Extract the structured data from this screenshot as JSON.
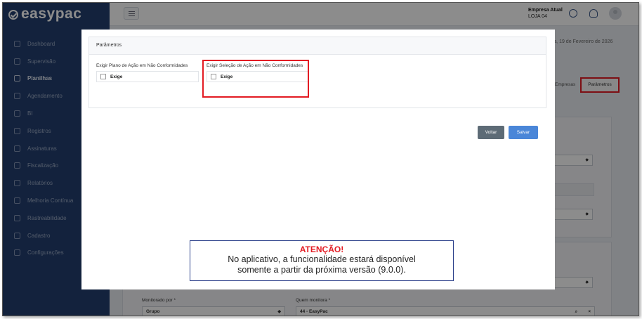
{
  "app": {
    "logo": "easypac"
  },
  "topbar": {
    "company_label": "Empresa Atual",
    "company_value": "LOJA 04"
  },
  "sidebar": {
    "items": [
      {
        "label": "Dashboard"
      },
      {
        "label": "Supervisão"
      },
      {
        "label": "Planilhas",
        "active": true
      },
      {
        "label": "Agendamento"
      },
      {
        "label": "BI"
      },
      {
        "label": "Registros"
      },
      {
        "label": "Assinaturas"
      },
      {
        "label": "Fiscalização"
      },
      {
        "label": "Relatórios"
      },
      {
        "label": "Melhoria Contínua"
      },
      {
        "label": "Rastreabilidade"
      },
      {
        "label": "Cadastro"
      },
      {
        "label": "Configurações"
      }
    ]
  },
  "background": {
    "date": "uinta, 19 de Fevereiro de 2026",
    "tabs": {
      "empresas": "Empresas",
      "parametros": "Parâmetros"
    },
    "monitorado_label": "Monitorado por *",
    "monitorado_value": "Grupo",
    "quem_monitora_label": "Quem monitora *",
    "quem_monitora_value": "44 - EasyPac"
  },
  "modal": {
    "section_title": "Parâmetros",
    "fields": [
      {
        "label": "Exigir Plano de Ação em Não Conformidades",
        "option": "Exige",
        "checked": false
      },
      {
        "label": "Exigir Seleção de Ação em Não Conformidades",
        "option": "Exige",
        "checked": false
      }
    ],
    "buttons": {
      "back": "Voltar",
      "save": "Salvar"
    }
  },
  "notice": {
    "title": "ATENÇÃO!",
    "line1": "No aplicativo, a funcionalidade estará disponível",
    "line2": "somente a partir da próxima versão (9.0.0)."
  },
  "colors": {
    "sidebar": "#233f70",
    "highlight": "#e31b23",
    "save": "#4a86d8",
    "back": "#5d6b76"
  }
}
